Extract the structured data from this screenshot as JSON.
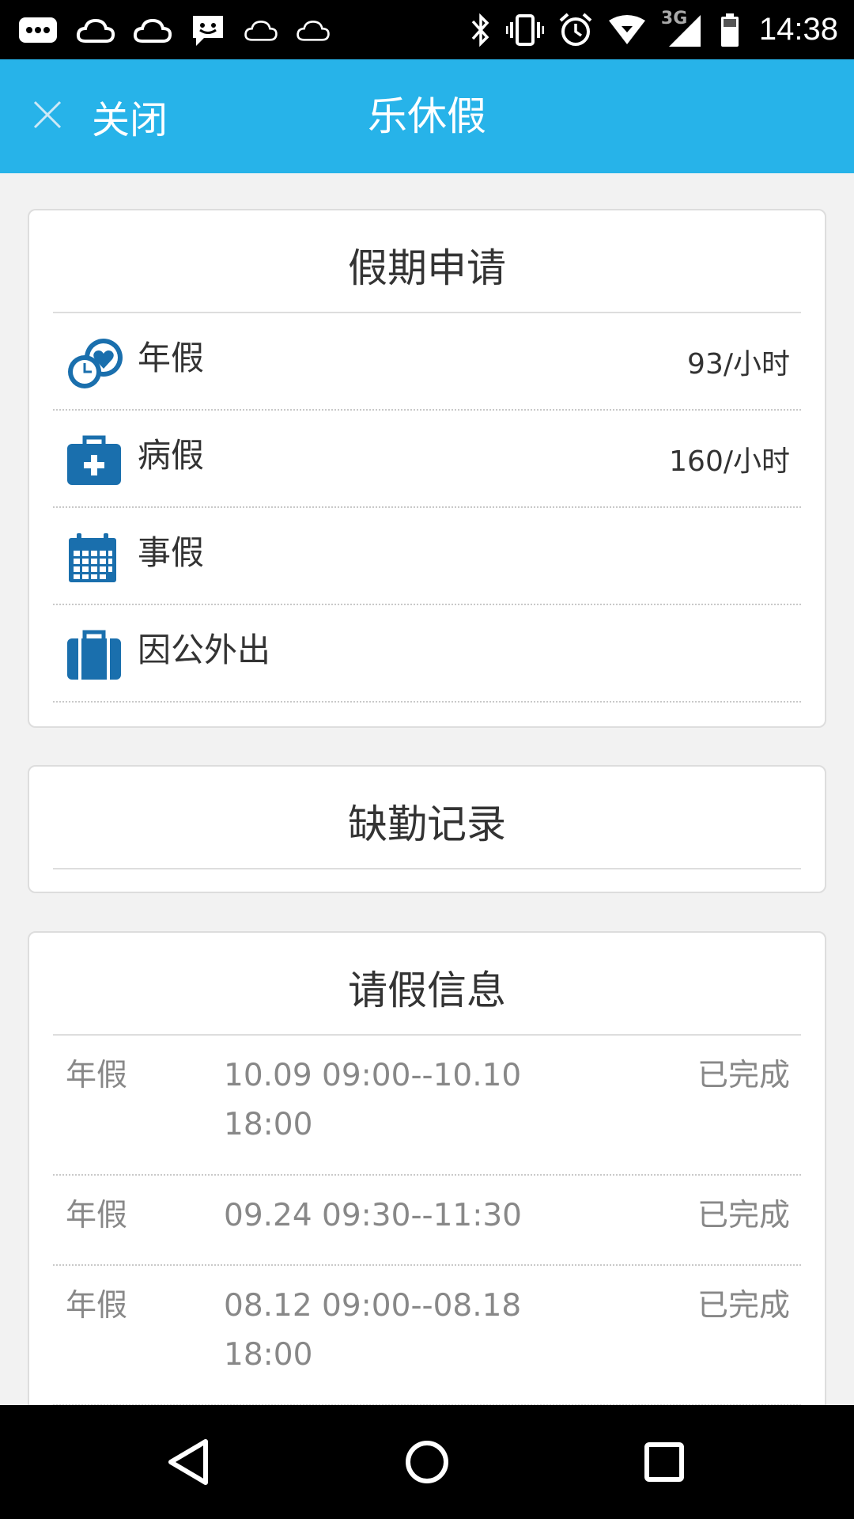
{
  "status_bar": {
    "time": "14:38",
    "network_type": "3G",
    "icons_left": [
      "more-icon",
      "cloud-icon",
      "cloud-icon",
      "message-icon",
      "cloud-outline-icon",
      "cloud-outline-icon"
    ],
    "icons_right": [
      "bluetooth-icon",
      "vibrate-icon",
      "alarm-icon",
      "wifi-icon",
      "signal-icon",
      "battery-icon"
    ]
  },
  "toolbar": {
    "close_label": "关闭",
    "title": "乐休假"
  },
  "vacation_apply": {
    "header": "假期申请",
    "items": [
      {
        "label": "年假",
        "value": "93/小时",
        "icon": "annual-leave-icon"
      },
      {
        "label": "病假",
        "value": "160/小时",
        "icon": "medical-kit-icon"
      },
      {
        "label": "事假",
        "value": "",
        "icon": "calendar-icon"
      },
      {
        "label": "因公外出",
        "value": "",
        "icon": "briefcase-icon"
      }
    ]
  },
  "absence_record": {
    "header": "缺勤记录"
  },
  "leave_info": {
    "header": "请假信息",
    "rows": [
      {
        "type": "年假",
        "time": "10.09 09:00--10.10 18:00",
        "status": "已完成"
      },
      {
        "type": "年假",
        "time": "09.24 09:30--11:30",
        "status": "已完成"
      },
      {
        "type": "年假",
        "time": "08.12 09:00--08.18 18:00",
        "status": "已完成"
      }
    ]
  },
  "colors": {
    "toolbar": "#27b3e9",
    "icon_blue": "#1a6fad"
  }
}
